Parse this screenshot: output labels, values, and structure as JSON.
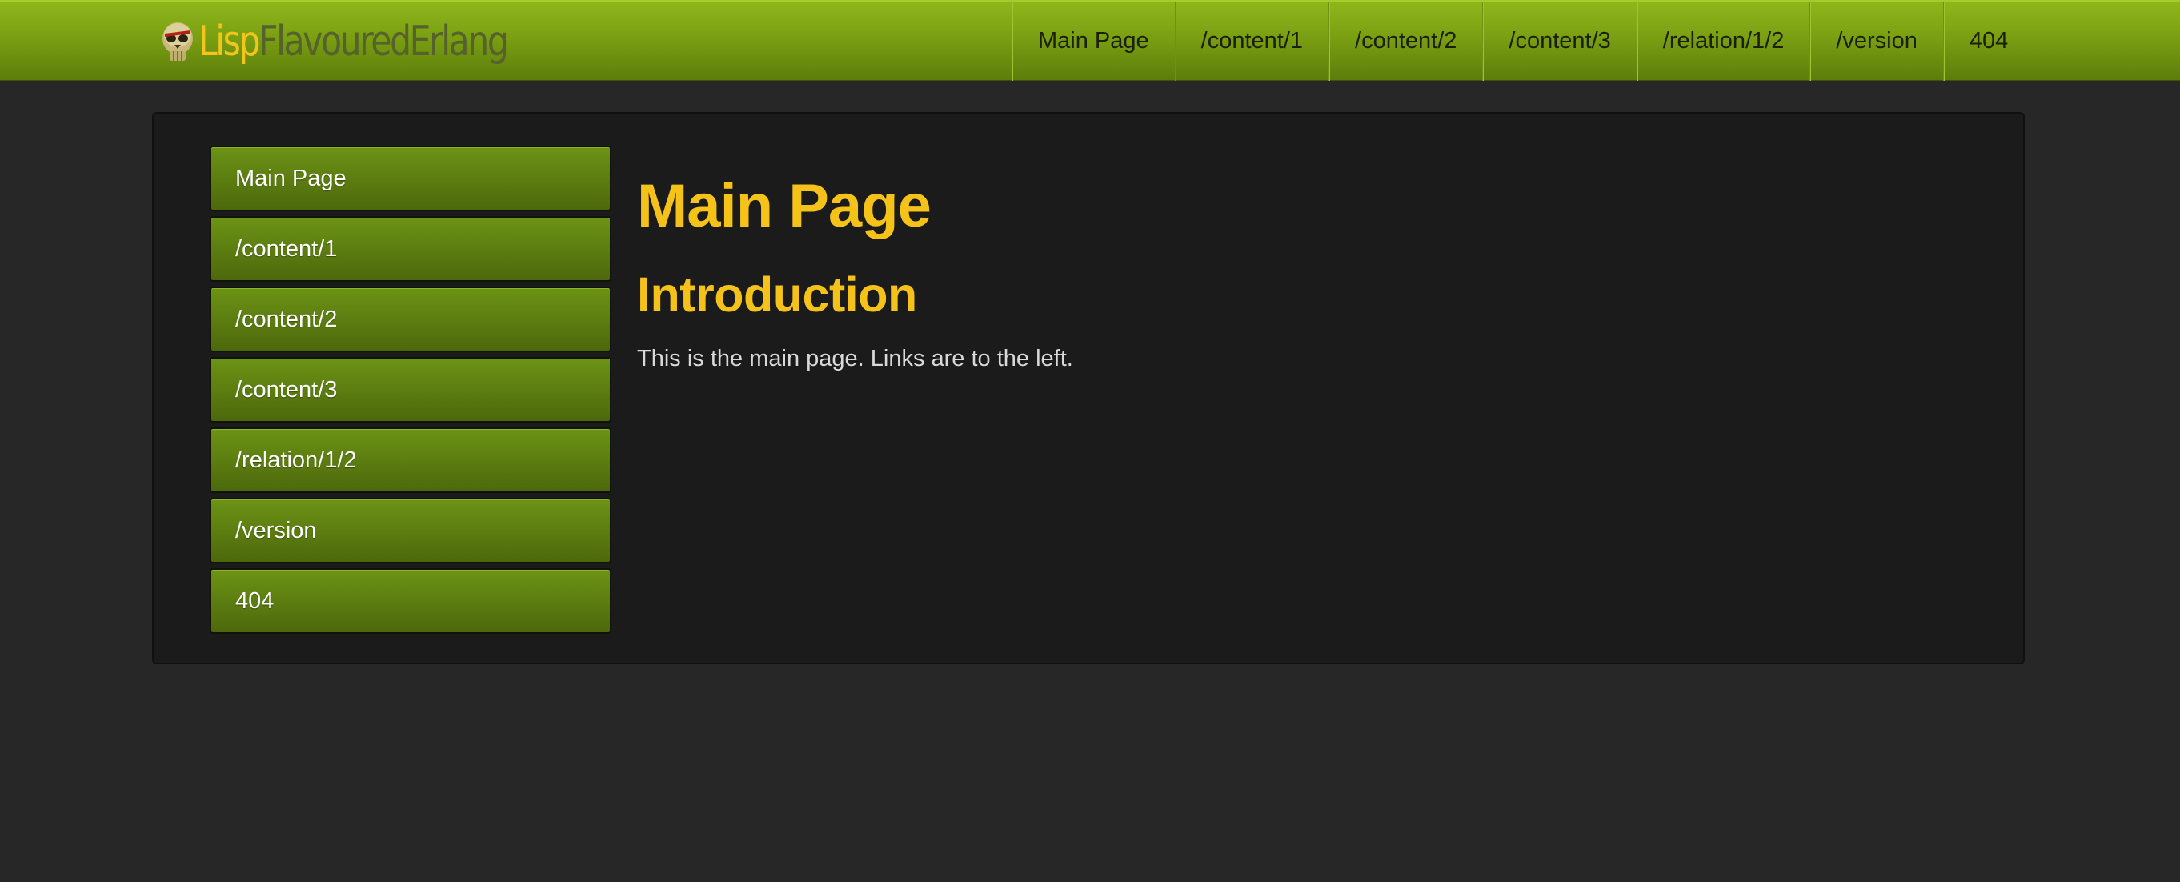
{
  "brand": {
    "lisp": "Lisp",
    "rest": "FlavouredErlang",
    "logo_icon": "skull-logo-icon"
  },
  "navbar": {
    "items": [
      {
        "label": "Main Page"
      },
      {
        "label": "/content/1"
      },
      {
        "label": "/content/2"
      },
      {
        "label": "/content/3"
      },
      {
        "label": "/relation/1/2"
      },
      {
        "label": "/version"
      },
      {
        "label": "404"
      }
    ]
  },
  "sidebar": {
    "items": [
      {
        "label": "Main Page"
      },
      {
        "label": "/content/1"
      },
      {
        "label": "/content/2"
      },
      {
        "label": "/content/3"
      },
      {
        "label": "/relation/1/2"
      },
      {
        "label": "/version"
      },
      {
        "label": "404"
      }
    ]
  },
  "main": {
    "title": "Main Page",
    "section_heading": "Introduction",
    "text": "This is the main page. Links are to the left."
  },
  "colors": {
    "accent": "#f5c21a",
    "navbar": "#7aa012",
    "background": "#272727",
    "panel": "#1b1b1b"
  }
}
